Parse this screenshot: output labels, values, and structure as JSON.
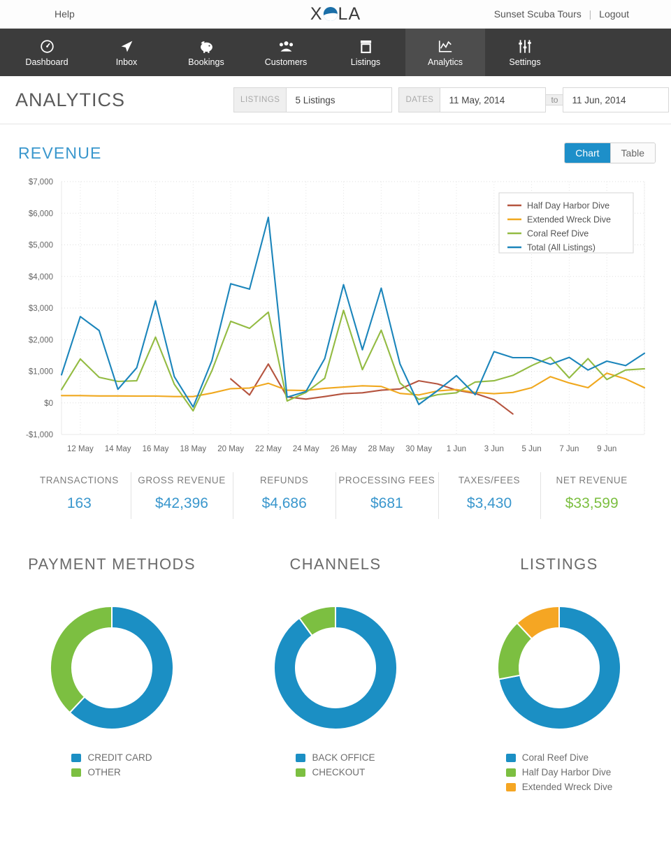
{
  "topbar": {
    "help": "Help",
    "logo_x": "X",
    "logo_la": "LA",
    "account": "Sunset Scuba Tours",
    "separator": "|",
    "logout": "Logout"
  },
  "nav": {
    "items": [
      {
        "label": "Dashboard",
        "icon": "speedometer-icon",
        "active": false
      },
      {
        "label": "Inbox",
        "icon": "paper-plane-icon",
        "active": false
      },
      {
        "label": "Bookings",
        "icon": "piggy-bank-icon",
        "active": false
      },
      {
        "label": "Customers",
        "icon": "people-icon",
        "active": false
      },
      {
        "label": "Listings",
        "icon": "box-icon",
        "active": false
      },
      {
        "label": "Analytics",
        "icon": "line-chart-icon",
        "active": true
      },
      {
        "label": "Settings",
        "icon": "sliders-icon",
        "active": false
      }
    ]
  },
  "page": {
    "title": "ANALYTICS",
    "listings_label": "LISTINGS",
    "listings_value": "5 Listings",
    "dates_label": "DATES",
    "date_from": "11 May, 2014",
    "date_to_word": "to",
    "date_to": "11 Jun, 2014"
  },
  "revenue": {
    "title": "REVENUE",
    "view_chart": "Chart",
    "view_table": "Table",
    "active_view": "Chart"
  },
  "chart_data": {
    "type": "line",
    "title": "REVENUE",
    "xlabel": "",
    "ylabel": "",
    "ylim": [
      -1000,
      7000
    ],
    "yticks": [
      "-$1,000",
      "$0",
      "$1,000",
      "$2,000",
      "$3,000",
      "$4,000",
      "$5,000",
      "$6,000",
      "$7,000"
    ],
    "ytick_values": [
      -1000,
      0,
      1000,
      2000,
      3000,
      4000,
      5000,
      6000,
      7000
    ],
    "grid": true,
    "legend_position": "top-right",
    "xtick_labels": [
      "12 May",
      "14 May",
      "16 May",
      "18 May",
      "20 May",
      "22 May",
      "24 May",
      "26 May",
      "28 May",
      "30 May",
      "1 Jun",
      "3 Jun",
      "5 Jun",
      "7 Jun",
      "9 Jun"
    ],
    "x": [
      "11 May",
      "12 May",
      "13 May",
      "14 May",
      "15 May",
      "16 May",
      "17 May",
      "18 May",
      "19 May",
      "20 May",
      "21 May",
      "22 May",
      "23 May",
      "24 May",
      "25 May",
      "26 May",
      "27 May",
      "28 May",
      "29 May",
      "30 May",
      "31 May",
      "1 Jun",
      "2 Jun",
      "3 Jun",
      "4 Jun",
      "5 Jun",
      "6 Jun",
      "7 Jun",
      "8 Jun",
      "9 Jun",
      "10 Jun",
      "11 Jun"
    ],
    "series": [
      {
        "name": "Half Day Harbor Dive",
        "color": "#b5543f",
        "values": [
          null,
          null,
          null,
          null,
          null,
          null,
          null,
          null,
          null,
          760,
          250,
          1230,
          190,
          120,
          200,
          290,
          320,
          400,
          440,
          700,
          600,
          400,
          300,
          100,
          -350,
          null,
          null,
          null,
          null,
          null,
          null,
          null
        ]
      },
      {
        "name": "Extended Wreck Dive",
        "color": "#f0a81e",
        "values": [
          230,
          230,
          220,
          220,
          215,
          215,
          200,
          200,
          310,
          450,
          470,
          620,
          400,
          390,
          460,
          500,
          540,
          520,
          300,
          250,
          380,
          420,
          330,
          290,
          330,
          480,
          830,
          630,
          480,
          940,
          760,
          480
        ]
      },
      {
        "name": "Coral Reef Dive",
        "color": "#93bb42",
        "values": [
          420,
          1390,
          810,
          680,
          700,
          2080,
          590,
          -250,
          1020,
          2580,
          2360,
          2870,
          60,
          330,
          780,
          2930,
          1050,
          2300,
          630,
          110,
          260,
          320,
          660,
          700,
          870,
          1180,
          1440,
          790,
          1400,
          740,
          1040,
          1080
        ]
      },
      {
        "name": "Total (All Listings)",
        "color": "#1b85bb",
        "values": [
          890,
          2730,
          2290,
          430,
          1110,
          3230,
          830,
          -130,
          1340,
          3770,
          3600,
          5870,
          180,
          360,
          1400,
          3740,
          1680,
          3630,
          1230,
          -50,
          390,
          860,
          260,
          1620,
          1430,
          1430,
          1220,
          1440,
          1040,
          1320,
          1180,
          1570
        ]
      }
    ]
  },
  "stats": [
    {
      "label": "TRANSACTIONS",
      "value": "163",
      "accent": "blue"
    },
    {
      "label": "GROSS REVENUE",
      "value": "$42,396",
      "accent": "blue"
    },
    {
      "label": "REFUNDS",
      "value": "$4,686",
      "accent": "blue"
    },
    {
      "label": "PROCESSING FEES",
      "value": "$681",
      "accent": "blue"
    },
    {
      "label": "TAXES/FEES",
      "value": "$3,430",
      "accent": "blue"
    },
    {
      "label": "NET REVENUE",
      "value": "$33,599",
      "accent": "green"
    }
  ],
  "donuts": [
    {
      "title": "PAYMENT METHODS",
      "type": "pie",
      "slices": [
        {
          "label": "CREDIT CARD",
          "value": 62,
          "color": "#1b8fc4"
        },
        {
          "label": "OTHER",
          "value": 38,
          "color": "#7cbf41"
        }
      ]
    },
    {
      "title": "CHANNELS",
      "type": "pie",
      "slices": [
        {
          "label": "BACK OFFICE",
          "value": 90,
          "color": "#1b8fc4"
        },
        {
          "label": "CHECKOUT",
          "value": 10,
          "color": "#7cbf41"
        }
      ]
    },
    {
      "title": "LISTINGS",
      "type": "pie",
      "slices": [
        {
          "label": "Coral Reef Dive",
          "value": 72,
          "color": "#1b8fc4"
        },
        {
          "label": "Half Day Harbor Dive",
          "value": 16,
          "color": "#7cbf41"
        },
        {
          "label": "Extended Wreck Dive",
          "value": 12,
          "color": "#f5a623"
        }
      ]
    }
  ],
  "colors": {
    "accent_blue": "#1b8fc4",
    "accent_green": "#7cbf41",
    "accent_orange": "#f5a623",
    "nav_bg": "#3c3c3c",
    "nav_active": "#4d4d4d"
  }
}
